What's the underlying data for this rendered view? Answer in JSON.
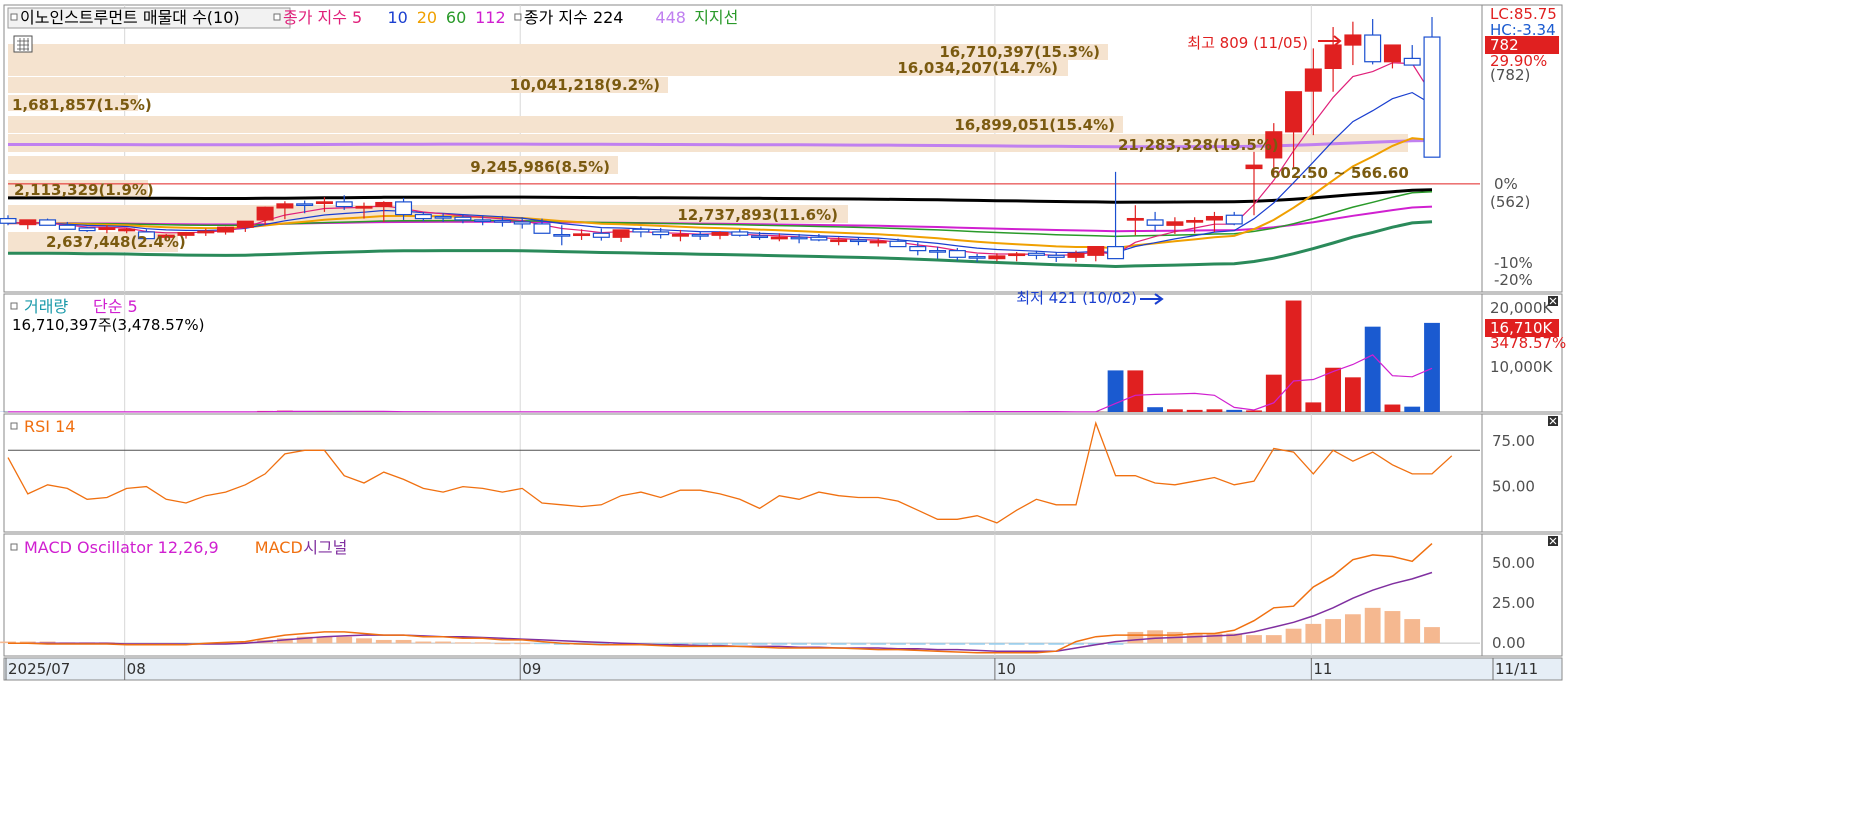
{
  "legend": {
    "price": [
      {
        "text": "이노인스트루먼트 매물대 수(10)",
        "color": "#000000",
        "boxed": true
      },
      {
        "text": "종가 지수 5",
        "color": "#e0207a"
      },
      {
        "text": "10",
        "color": "#1a3fd0"
      },
      {
        "text": "20",
        "color": "#f0a000"
      },
      {
        "text": "60",
        "color": "#2a9a2a"
      },
      {
        "text": "112",
        "color": "#d020d0"
      },
      {
        "text": "종가 지수 224",
        "color": "#000000"
      },
      {
        "text": "448",
        "color": "#c080f0"
      },
      {
        "text": "지지선",
        "color": "#2a9a2a"
      }
    ],
    "volume": [
      {
        "text": "거래량",
        "color": "#1a9aaa"
      },
      {
        "text": "단순 5",
        "color": "#d020d0"
      }
    ],
    "volume_info": "16,710,397주(3,478.57%)",
    "rsi": [
      {
        "text": "RSI 14",
        "color": "#f07010"
      }
    ],
    "macd": [
      {
        "text": "MACD Oscillator 12,26,9",
        "color": "#d020d0"
      },
      {
        "text": "MACD",
        "color": "#f07010"
      },
      {
        "text": "시그널",
        "color": "#8030a0"
      }
    ]
  },
  "right_axis": {
    "price_labels": [
      "LC:85.75",
      "HC:-3.34",
      "782",
      "29.90%",
      "(782)",
      "0%",
      "(562)",
      "-10%",
      "-20%"
    ],
    "volume_labels": [
      "20,000K",
      "16,710K",
      "3478.57%",
      "10,000K"
    ],
    "rsi_labels": [
      "75.00",
      "50.00"
    ],
    "macd_labels": [
      "50.00",
      "25.00",
      "0.00"
    ]
  },
  "x_axis": {
    "labels": [
      "2025/07",
      "08",
      "09",
      "10",
      "11",
      "11/11"
    ]
  },
  "annotations": {
    "high": "최고 809 (11/05)",
    "low": "최저 421 (10/02)",
    "range": "602.50 ~ 566.60"
  },
  "chart_data": [
    {
      "type": "candlestick",
      "title": "이노인스트루먼트 매물대 수(10)",
      "ylim": [
        400,
        830
      ],
      "prev_close": 562,
      "dates": [
        "07/24",
        "07/25",
        "07/28",
        "07/29",
        "07/30",
        "07/31",
        "08/01",
        "08/04",
        "08/05",
        "08/06",
        "08/07",
        "08/08",
        "08/11",
        "08/12",
        "08/13",
        "08/14",
        "08/18",
        "08/19",
        "08/20",
        "08/21",
        "08/22",
        "08/25",
        "08/26",
        "08/27",
        "08/28",
        "08/29",
        "09/01",
        "09/02",
        "09/03",
        "09/04",
        "09/05",
        "09/08",
        "09/09",
        "09/10",
        "09/11",
        "09/12",
        "09/15",
        "09/16",
        "09/17",
        "09/18",
        "09/19",
        "09/22",
        "09/23",
        "09/24",
        "09/25",
        "09/26",
        "09/29",
        "09/30",
        "10/01",
        "10/02",
        "10/10",
        "10/13",
        "10/14",
        "10/15",
        "10/16",
        "10/17",
        "10/20",
        "10/21",
        "10/22",
        "10/23",
        "10/24",
        "10/27",
        "10/28",
        "10/29",
        "10/30",
        "10/31",
        "11/03",
        "11/04",
        "11/05",
        "11/06",
        "11/07",
        "11/10",
        "11/11"
      ],
      "open": [
        510,
        501,
        508,
        500,
        496,
        494,
        492,
        490,
        482,
        485,
        489,
        490,
        497,
        508,
        526,
        532,
        535,
        535,
        528,
        528,
        535,
        516,
        513,
        512,
        508,
        507,
        505,
        502,
        486,
        485,
        488,
        482,
        494,
        490,
        484,
        486,
        485,
        490,
        484,
        482,
        482,
        482,
        478,
        478,
        476,
        476,
        468,
        462,
        462,
        453,
        450,
        455,
        458,
        455,
        452,
        455,
        468,
        510,
        508,
        500,
        505,
        508,
        515,
        585,
        601,
        640,
        701,
        735,
        770,
        785,
        745,
        750,
        782
      ],
      "high": [
        515,
        508,
        510,
        505,
        498,
        500,
        496,
        494,
        487,
        490,
        495,
        498,
        505,
        528,
        536,
        537,
        542,
        545,
        534,
        536,
        541,
        520,
        518,
        516,
        515,
        514,
        512,
        510,
        500,
        494,
        495,
        490,
        498,
        496,
        493,
        491,
        491,
        494,
        490,
        488,
        487,
        487,
        482,
        482,
        480,
        480,
        474,
        468,
        466,
        457,
        458,
        460,
        462,
        460,
        462,
        462,
        580,
        530,
        520,
        512,
        512,
        520,
        520,
        610,
        653,
        680,
        765,
        797,
        805,
        809,
        770,
        770,
        812
      ],
      "low": [
        500,
        494,
        501,
        495,
        490,
        488,
        488,
        482,
        478,
        480,
        484,
        486,
        490,
        500,
        509,
        518,
        520,
        523,
        510,
        505,
        508,
        506,
        505,
        503,
        500,
        498,
        495,
        495,
        470,
        478,
        477,
        475,
        482,
        480,
        476,
        478,
        479,
        483,
        478,
        476,
        473,
        476,
        470,
        470,
        468,
        468,
        455,
        450,
        447,
        445,
        446,
        446,
        449,
        445,
        445,
        446,
        453,
        485,
        491,
        487,
        488,
        490,
        500,
        515,
        575,
        585,
        635,
        700,
        740,
        741,
        735,
        740,
        735
      ],
      "close": [
        503,
        508,
        500,
        494,
        492,
        496,
        494,
        480,
        485,
        489,
        491,
        497,
        506,
        527,
        532,
        530,
        535,
        528,
        528,
        534,
        516,
        510,
        512,
        508,
        507,
        505,
        502,
        488,
        484,
        487,
        482,
        493,
        490,
        486,
        486,
        484,
        489,
        485,
        482,
        482,
        480,
        478,
        478,
        476,
        476,
        468,
        462,
        461,
        452,
        451,
        454,
        457,
        455,
        452,
        458,
        468,
        450,
        510,
        500,
        505,
        507,
        513,
        502,
        590,
        640,
        700,
        734,
        770,
        785,
        745,
        770,
        740,
        602
      ]
    },
    {
      "type": "bar",
      "title": "거래량",
      "ylim": [
        0,
        21000
      ],
      "values": [
        30,
        25,
        30,
        20,
        20,
        20,
        20,
        20,
        20,
        20,
        25,
        30,
        30,
        200,
        250,
        100,
        80,
        60,
        40,
        40,
        40,
        40,
        40,
        40,
        30,
        30,
        30,
        30,
        30,
        30,
        30,
        30,
        30,
        30,
        30,
        30,
        30,
        30,
        30,
        30,
        30,
        30,
        30,
        30,
        30,
        30,
        30,
        30,
        80,
        150,
        40,
        40,
        40,
        40,
        40,
        40,
        7800,
        7800,
        900,
        500,
        400,
        500,
        400,
        300,
        7000,
        20900,
        1800,
        8300,
        6500,
        16000,
        1400,
        1000,
        16710
      ],
      "ma5": [
        30,
        30,
        30,
        28,
        25,
        22,
        22,
        20,
        20,
        20,
        21,
        23,
        25,
        62,
        106,
        120,
        130,
        140,
        130,
        110,
        60,
        50,
        44,
        40,
        40,
        36,
        34,
        32,
        32,
        30,
        30,
        30,
        30,
        30,
        30,
        30,
        30,
        30,
        30,
        30,
        30,
        30,
        30,
        30,
        30,
        30,
        30,
        30,
        42,
        68,
        73,
        74,
        80,
        66,
        46,
        44,
        1610,
        3130,
        3300,
        3380,
        3480,
        3140,
        860,
        380,
        1730,
        5810,
        6100,
        7580,
        8900,
        10700,
        6800,
        6600,
        8200
      ]
    },
    {
      "type": "line",
      "title": "RSI 14",
      "ylim": [
        25,
        90
      ],
      "values": [
        66,
        46,
        51,
        49,
        43,
        44,
        49,
        50,
        43,
        41,
        45,
        47,
        51,
        57,
        68,
        70,
        70,
        56,
        52,
        58,
        54,
        49,
        47,
        50,
        49,
        47,
        49,
        41,
        40,
        39,
        40,
        45,
        47,
        44,
        48,
        48,
        46,
        43,
        38,
        45,
        43,
        47,
        45,
        44,
        44,
        42,
        37,
        32,
        32,
        34,
        30,
        37,
        43,
        40,
        40,
        85,
        56,
        56,
        52,
        51,
        53,
        55,
        51,
        53,
        71,
        69,
        57,
        70,
        64,
        69,
        62,
        57,
        57,
        67
      ]
    },
    {
      "type": "bar",
      "title": "MACD Oscillator 12,26,9",
      "ylim": [
        -8,
        68
      ],
      "oscillator": [
        1,
        1,
        1,
        0.5,
        0.5,
        0.5,
        0,
        0,
        0,
        -0.5,
        0,
        0.5,
        1,
        2,
        3,
        4,
        4,
        4,
        3,
        2,
        2,
        1,
        1,
        0.5,
        0.5,
        0,
        0,
        -0.5,
        -1,
        -1,
        -1,
        -1,
        -1,
        -1,
        -1,
        -1,
        -1,
        -1,
        -1,
        -1,
        -1,
        -1,
        -1,
        -1,
        -1,
        -1,
        -1,
        -1,
        -1,
        -1,
        -1,
        -1,
        -1,
        -1,
        -1,
        -1,
        -1,
        7,
        8,
        7,
        6,
        6,
        6,
        5,
        5,
        9,
        12,
        15,
        18,
        22,
        20,
        15,
        10,
        16
      ],
      "macd": [
        0,
        0,
        -0.5,
        -0.5,
        -0.5,
        -0.5,
        -1,
        -1,
        -1,
        -1,
        0,
        0.5,
        1,
        3,
        5,
        6,
        7,
        7,
        6,
        5,
        5,
        4,
        4,
        3,
        3,
        2,
        2,
        1,
        0,
        -0.5,
        -1,
        -1,
        -1,
        -1.5,
        -2,
        -2,
        -2,
        -2,
        -2.5,
        -3,
        -3,
        -3,
        -3,
        -3.5,
        -4,
        -4,
        -4.5,
        -5,
        -5.5,
        -6,
        -6,
        -6,
        -6,
        -5,
        1,
        4,
        5,
        5,
        5,
        5,
        6,
        6,
        8,
        14,
        22,
        23,
        35,
        42,
        52,
        55,
        54,
        51,
        62
      ],
      "signal": [
        0,
        0,
        0,
        0,
        0,
        0,
        -0.5,
        -0.5,
        -0.5,
        -0.5,
        -0.5,
        -0.5,
        0,
        1,
        2,
        3,
        4,
        4.5,
        5,
        5,
        5,
        4.5,
        4,
        4,
        3.5,
        3,
        2.5,
        2,
        1.5,
        1,
        0.5,
        0,
        -0.5,
        -1,
        -1,
        -1.5,
        -1.5,
        -2,
        -2,
        -2,
        -2.5,
        -2.5,
        -3,
        -3,
        -3,
        -3.5,
        -3.5,
        -4,
        -4,
        -4.5,
        -5,
        -5,
        -5,
        -5,
        -3,
        -1,
        1,
        2,
        3,
        3.5,
        4,
        4.5,
        5,
        7,
        10,
        13,
        17,
        22,
        28,
        33,
        37,
        40,
        44
      ]
    }
  ]
}
